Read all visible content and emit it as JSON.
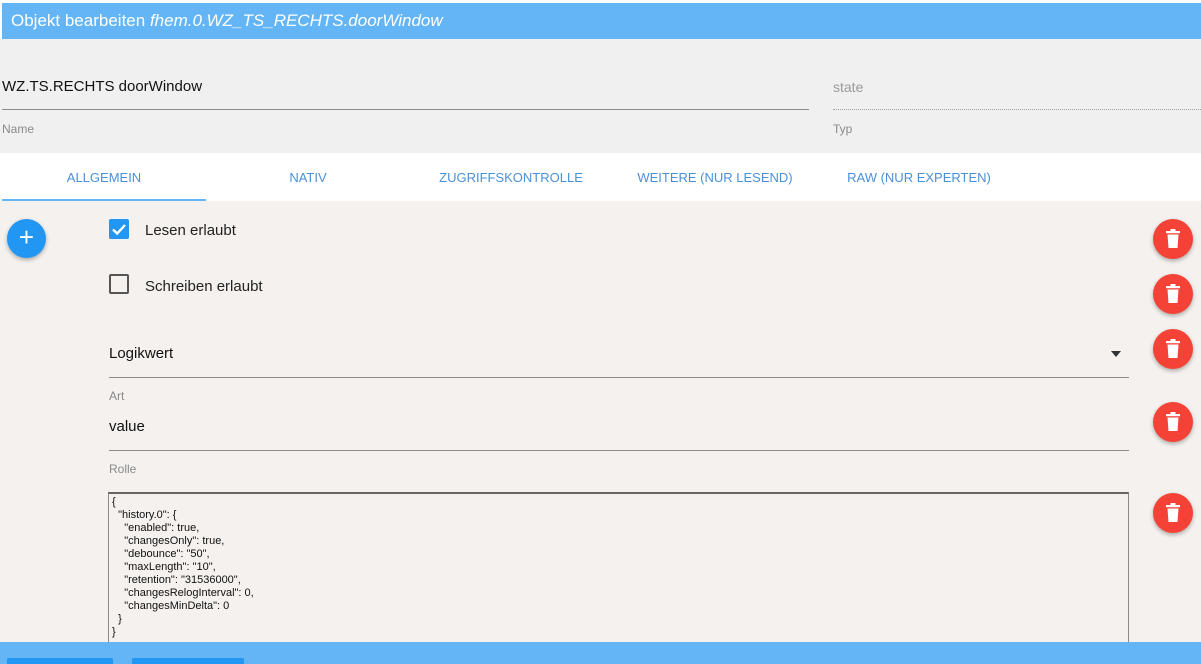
{
  "title": {
    "prefix": "Objekt bearbeiten",
    "object_id": "fhem.0.WZ_TS_RECHTS.doorWindow"
  },
  "header": {
    "name_value": "WZ.TS.RECHTS doorWindow",
    "name_label": "Name",
    "typ_value": "state",
    "typ_label": "Typ"
  },
  "tabs": [
    {
      "label": "ALLGEMEIN",
      "active": true
    },
    {
      "label": "NATIV",
      "active": false
    },
    {
      "label": "ZUGRIFFSKONTROLLE",
      "active": false
    },
    {
      "label": "WEITERE (NUR LESEND)",
      "active": false
    },
    {
      "label": "RAW (NUR EXPERTEN)",
      "active": false
    }
  ],
  "form": {
    "read_label": "Lesen erlaubt",
    "read_checked": true,
    "write_label": "Schreiben erlaubt",
    "write_checked": false,
    "type_value": "Logikwert",
    "type_label": "Art",
    "role_value": "value",
    "role_label": "Rolle",
    "custom_json": "{\n  \"history.0\": {\n    \"enabled\": true,\n    \"changesOnly\": true,\n    \"debounce\": \"50\",\n    \"maxLength\": \"10\",\n    \"retention\": \"31536000\",\n    \"changesRelogInterval\": 0,\n    \"changesMinDelta\": 0\n  }\n}"
  },
  "icons": {
    "add": "plus-icon",
    "delete": "trash-icon",
    "check": "check-icon",
    "dropdown": "caret-down-icon"
  },
  "colors": {
    "primary": "#64b5f6",
    "accent": "#2196f3",
    "danger": "#f44336",
    "tab_text": "#4a90d9"
  }
}
